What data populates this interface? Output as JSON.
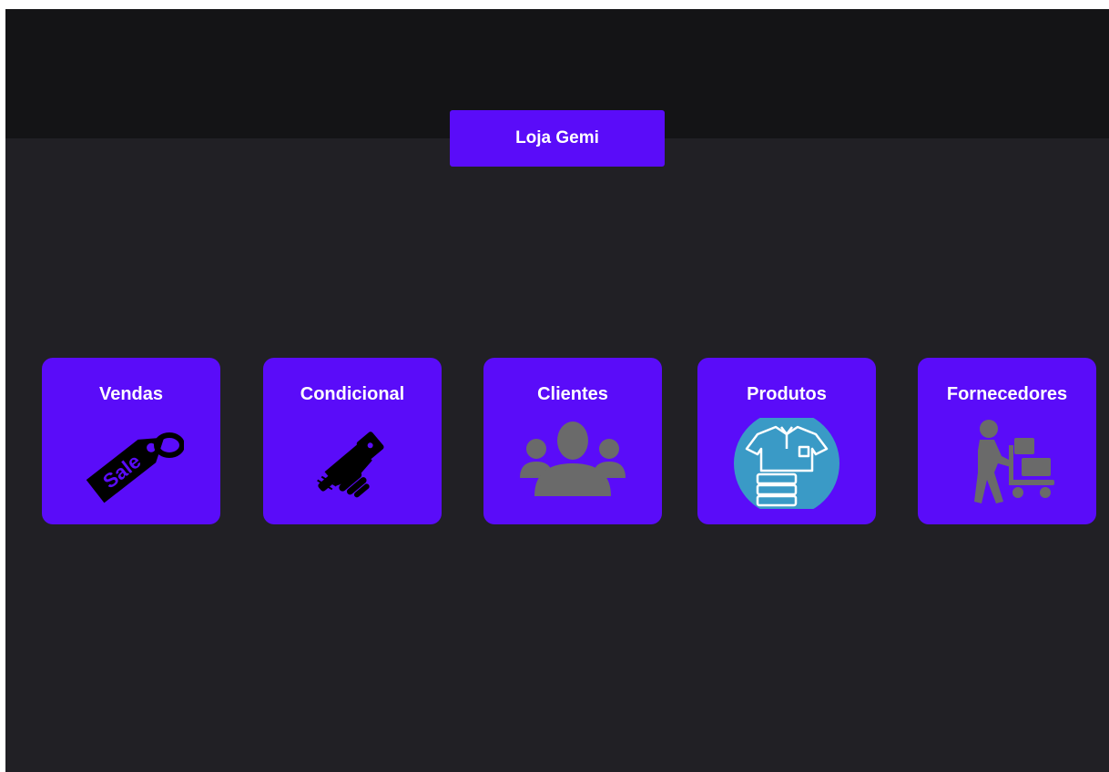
{
  "header": {
    "title": "Loja Gemi"
  },
  "colors": {
    "background": "#212025",
    "header": "#141416",
    "accent": "#5a0cf9",
    "icon_gray": "#6a6a6a",
    "icon_teal": "#3a9ac6"
  },
  "tiles": [
    {
      "label": "Vendas",
      "icon": "sale-tag-icon"
    },
    {
      "label": "Condicional",
      "icon": "handshake-icon"
    },
    {
      "label": "Clientes",
      "icon": "users-group-icon"
    },
    {
      "label": "Produtos",
      "icon": "shirt-stack-icon"
    },
    {
      "label": "Fornecedores",
      "icon": "delivery-person-icon"
    }
  ],
  "icon_text": {
    "sale": "Sale"
  }
}
